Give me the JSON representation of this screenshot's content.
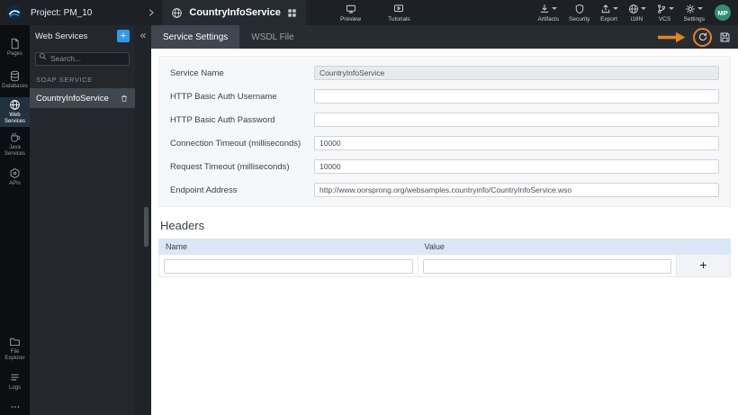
{
  "colors": {
    "accent_blue": "#2E9BE6",
    "annotation_orange": "#E8831D",
    "table_header_blue": "#D9E7F6",
    "avatar_green": "#2F8F6F"
  },
  "topbar": {
    "project_label": "Project: PM_10",
    "service_tab": "CountryInfoService",
    "preview_label": "Preview",
    "tutorials_label": "Tutorials",
    "artifacts_label": "Artifacts",
    "security_label": "Security",
    "export_label": "Export",
    "i18n_label": "i18N",
    "vcs_label": "VCS",
    "settings_label": "Settings",
    "avatar_initials": "MP"
  },
  "sidebar": {
    "items": [
      {
        "label": "Pages"
      },
      {
        "label": "Databases"
      },
      {
        "label": "Web Services"
      },
      {
        "label": "Java Services"
      },
      {
        "label": "APIs"
      }
    ],
    "bottom_items": [
      {
        "label": "File Explorer"
      },
      {
        "label": "Logs"
      }
    ]
  },
  "panel": {
    "title": "Web Services",
    "add_button": "+",
    "collapse_button": "«",
    "search_placeholder": "Search...",
    "section_label": "SOAP SERVICE",
    "service_item": "CountryInfoService"
  },
  "main": {
    "tabs": {
      "settings": "Service Settings",
      "wsdl": "WSDL File"
    },
    "form": {
      "fields": [
        {
          "label": "Service Name",
          "value": "CountryInfoService"
        },
        {
          "label": "HTTP Basic Auth Username",
          "value": ""
        },
        {
          "label": "HTTP Basic Auth Password",
          "value": ""
        },
        {
          "label": "Connection Timeout (milliseconds)",
          "value": "10000"
        },
        {
          "label": "Request Timeout (milliseconds)",
          "value": "10000"
        },
        {
          "label": "Endpoint Address",
          "value": "http://www.oorsprong.org/websamples.countryinfo/CountryInfoService.wso"
        }
      ]
    },
    "headers": {
      "title": "Headers",
      "columns": {
        "name": "Name",
        "value": "Value"
      },
      "add_button": "+"
    }
  }
}
